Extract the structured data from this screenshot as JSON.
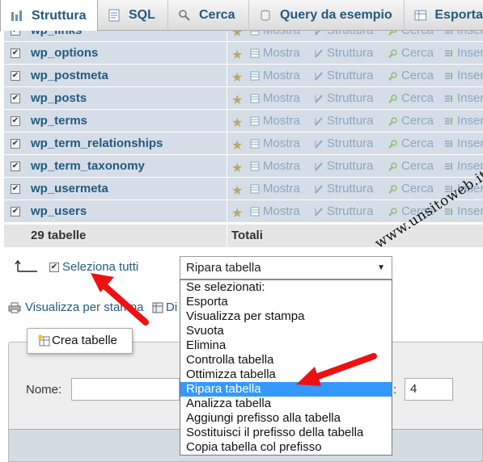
{
  "tabs": [
    {
      "label": "Struttura",
      "icon": "structure-icon",
      "active": true
    },
    {
      "label": "SQL",
      "icon": "sql-icon",
      "active": false
    },
    {
      "label": "Cerca",
      "icon": "search-icon",
      "active": false
    },
    {
      "label": "Query da esempio",
      "icon": "query-icon",
      "active": false
    },
    {
      "label": "Esporta",
      "icon": "export-icon",
      "active": false
    }
  ],
  "tables": {
    "rows": [
      {
        "name": "wp_links",
        "checked": true
      },
      {
        "name": "wp_options",
        "checked": true
      },
      {
        "name": "wp_postmeta",
        "checked": true
      },
      {
        "name": "wp_posts",
        "checked": true
      },
      {
        "name": "wp_terms",
        "checked": true
      },
      {
        "name": "wp_term_relationships",
        "checked": true
      },
      {
        "name": "wp_term_taxonomy",
        "checked": true
      },
      {
        "name": "wp_usermeta",
        "checked": true
      },
      {
        "name": "wp_users",
        "checked": true
      }
    ],
    "actions": {
      "browse": "Mostra",
      "structure": "Struttura",
      "search": "Cerca",
      "insert": "Inser"
    },
    "footer": {
      "count": "29 tabelle",
      "totals": "Totali"
    }
  },
  "bulk": {
    "select_all": "Seleziona tutti",
    "selected_option": "Ripara tabella",
    "options": [
      "Se selezionati:",
      "Esporta",
      "Visualizza per stampa",
      "Svuota",
      "Elimina",
      "Controlla tabella",
      "Ottimizza tabella",
      "Ripara tabella",
      "Analizza tabella",
      "Aggiungi prefisso alla tabella",
      "Sostituisci il prefisso della tabella",
      "Copia tabella col prefisso"
    ],
    "highlighted_index": 7
  },
  "links": {
    "print_view": "Visualizza per stampa",
    "dictionary": "Di"
  },
  "create": {
    "legend": "Crea tabelle",
    "name_label": "Nome:",
    "name_value": "",
    "colon": ":",
    "columns_value": "4"
  },
  "watermark": "www.unsitoweb.it",
  "colors": {
    "link": "#235a81",
    "row_bg": "#d5dde6",
    "highlight": "#3399ff",
    "annotation_arrow": "#ee1111"
  }
}
